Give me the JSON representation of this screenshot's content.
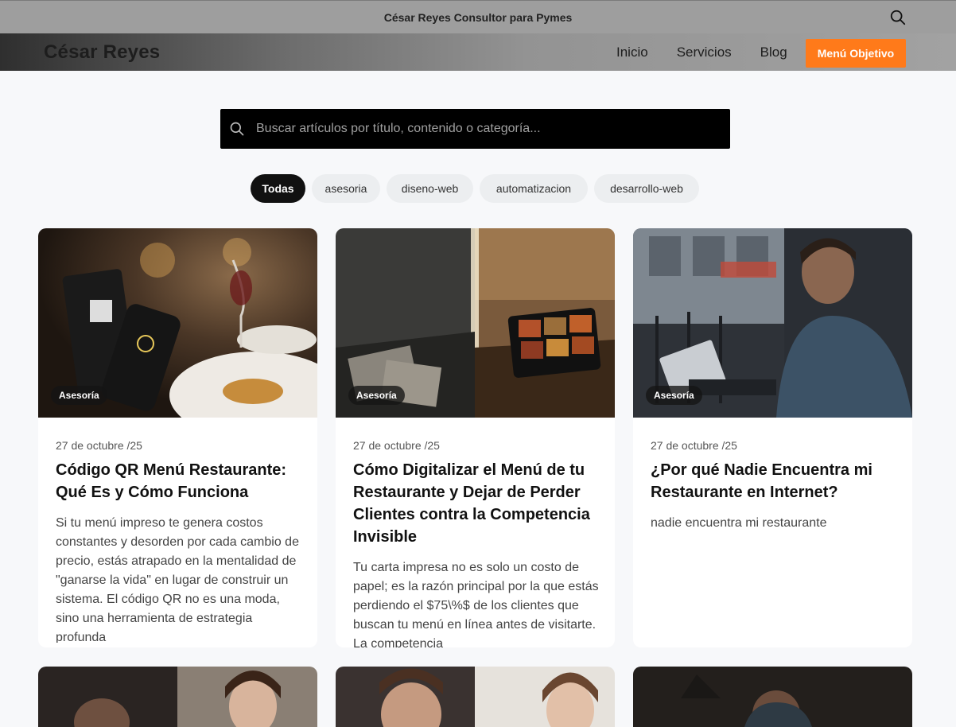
{
  "topbar": {
    "title": "César Reyes Consultor para Pymes",
    "search_icon": "search-icon"
  },
  "nav": {
    "brand": "César Reyes",
    "links": [
      "Inicio",
      "Servicios",
      "Blog"
    ],
    "cta": "Menú Objetivo",
    "cta_color": "#ff7a1a"
  },
  "search": {
    "placeholder": "Buscar artículos por título, contenido o categoría..."
  },
  "filters": [
    "Todas",
    "asesoria",
    "diseno-web",
    "automatizacion",
    "desarrollo-web"
  ],
  "posts": [
    {
      "category": "Asesoría",
      "date": "27 de octubre /25",
      "title": "Código QR Menú Restaurante: Qué Es y Cómo Funciona",
      "excerpt": "Si tu menú impreso te genera costos constantes y desorden por cada cambio de precio, estás atrapado en la mentalidad de \"ganarse la vida\" en lugar de construir un sistema. El código QR no es una moda, sino una herramienta de estrategia profunda"
    },
    {
      "category": "Asesoría",
      "date": "27 de octubre /25",
      "title": "Cómo Digitalizar el Menú de tu Restaurante y Dejar de Perder Clientes contra la Competencia Invisible",
      "excerpt": "Tu carta impresa no es solo un costo de papel; es la razón principal por la que estás perdiendo el $75\\%$ de los clientes que buscan tu menú en línea antes de visitarte. La competencia"
    },
    {
      "category": "Asesoría",
      "date": "27 de octubre /25",
      "title": "¿Por qué Nadie Encuentra mi Restaurante en Internet?",
      "excerpt": "nadie encuentra mi restaurante"
    }
  ]
}
